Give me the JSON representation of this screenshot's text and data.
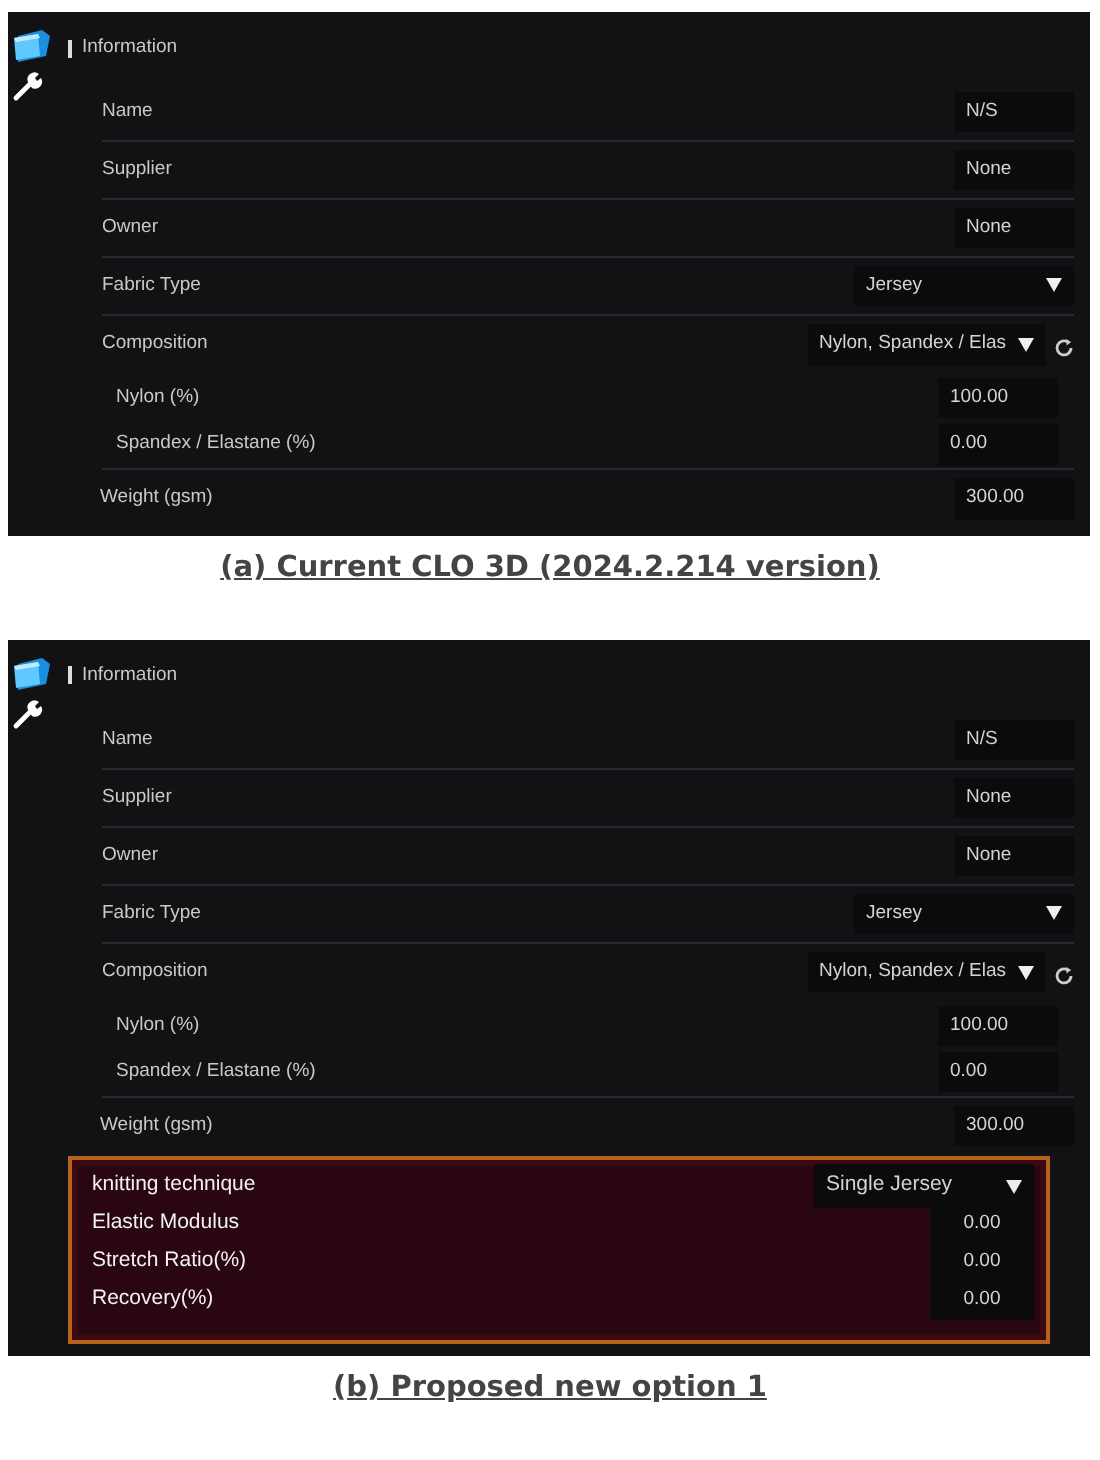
{
  "panels": [
    {
      "header": "Information",
      "rows": [
        {
          "kind": "field",
          "label": "Name",
          "value": "N/S"
        },
        {
          "kind": "field",
          "label": "Supplier",
          "value": "None"
        },
        {
          "kind": "field",
          "label": "Owner",
          "value": "None"
        },
        {
          "kind": "dropdown",
          "label": "Fabric Type",
          "value": "Jersey"
        },
        {
          "kind": "dropdown_reset",
          "label": "Composition",
          "value": "Nylon, Spandex / Elas"
        },
        {
          "kind": "sub",
          "label": "Nylon (%)",
          "value": "100.00"
        },
        {
          "kind": "sub",
          "label": "Spandex / Elastane (%)",
          "value": "0.00"
        },
        {
          "kind": "plain",
          "label": "Weight (gsm)",
          "value": "300.00"
        }
      ],
      "caption": "(a) Current CLO 3D (2024.2.214 version)"
    },
    {
      "header": "Information",
      "rows": [
        {
          "kind": "field",
          "label": "Name",
          "value": "N/S"
        },
        {
          "kind": "field",
          "label": "Supplier",
          "value": "None"
        },
        {
          "kind": "field",
          "label": "Owner",
          "value": "None"
        },
        {
          "kind": "dropdown",
          "label": "Fabric Type",
          "value": "Jersey"
        },
        {
          "kind": "dropdown_reset",
          "label": "Composition",
          "value": "Nylon, Spandex / Elas"
        },
        {
          "kind": "sub",
          "label": "Nylon (%)",
          "value": "100.00"
        },
        {
          "kind": "sub",
          "label": "Spandex / Elastane (%)",
          "value": "0.00"
        },
        {
          "kind": "plain",
          "label": "Weight (gsm)",
          "value": "300.00"
        }
      ],
      "proposed": [
        {
          "kind": "dropdown",
          "label": "knitting technique",
          "value": "Single Jersey"
        },
        {
          "kind": "field",
          "label": "Elastic Modulus",
          "value": "0.00"
        },
        {
          "kind": "field",
          "label": "Stretch Ratio(%)",
          "value": "0.00"
        },
        {
          "kind": "field",
          "label": "Recovery(%)",
          "value": "0.00"
        }
      ],
      "caption": "(b) Proposed new option 1"
    }
  ]
}
